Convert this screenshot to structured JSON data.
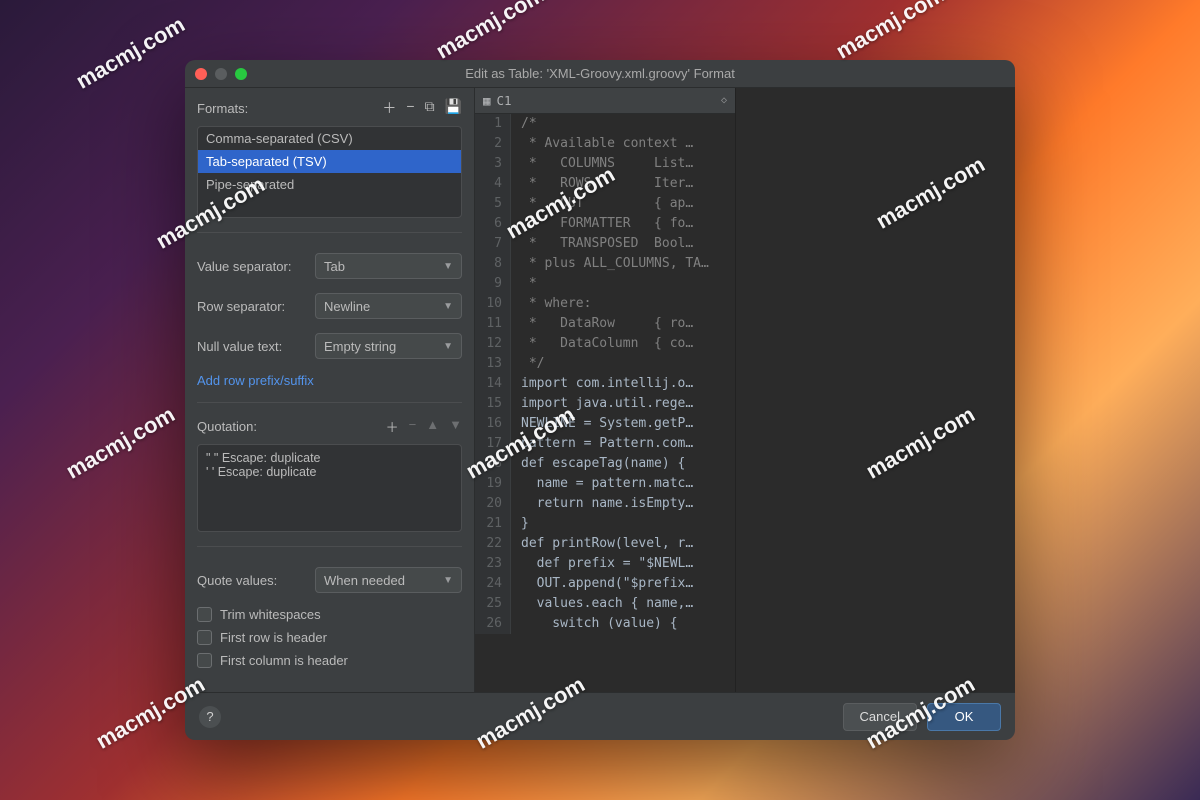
{
  "window": {
    "title": "Edit as Table: 'XML-Groovy.xml.groovy' Format"
  },
  "formats": {
    "label": "Formats:",
    "items": [
      {
        "label": "Comma-separated (CSV)",
        "selected": false
      },
      {
        "label": "Tab-separated (TSV)",
        "selected": true
      },
      {
        "label": "Pipe-separated",
        "selected": false
      }
    ]
  },
  "settings": {
    "value_separator_label": "Value separator:",
    "value_separator": "Tab",
    "row_separator_label": "Row separator:",
    "row_separator": "Newline",
    "null_text_label": "Null value text:",
    "null_text": "Empty string",
    "add_prefix_link": "Add row prefix/suffix",
    "quotation_label": "Quotation:",
    "quotation_lines": [
      "\" \"  Escape: duplicate",
      "' '  Escape: duplicate"
    ],
    "quote_values_label": "Quote values:",
    "quote_values": "When needed",
    "checks": {
      "trim": "Trim whitespaces",
      "first_row": "First row is header",
      "first_col": "First column is header"
    }
  },
  "code": {
    "column_header": "C1",
    "lines": [
      "/*",
      " * Available context …",
      " *   COLUMNS     List…",
      " *   ROWS        Iter…",
      " *   OUT         { ap…",
      " *   FORMATTER   { fo…",
      " *   TRANSPOSED  Bool…",
      " * plus ALL_COLUMNS, TA…",
      " *",
      " * where:",
      " *   DataRow     { ro…",
      " *   DataColumn  { co…",
      " */",
      "import com.intellij.o…",
      "import java.util.rege…",
      "NEWLINE = System.getP…",
      "pattern = Pattern.com…",
      "def escapeTag(name) {",
      "  name = pattern.matc…",
      "  return name.isEmpty…",
      "}",
      "def printRow(level, r…",
      "  def prefix = \"$NEWL…",
      "  OUT.append(\"$prefix…",
      "  values.each { name,…",
      "    switch (value) {"
    ]
  },
  "footer": {
    "help": "?",
    "cancel": "Cancel",
    "ok": "OK"
  },
  "watermark": "macmj.com"
}
